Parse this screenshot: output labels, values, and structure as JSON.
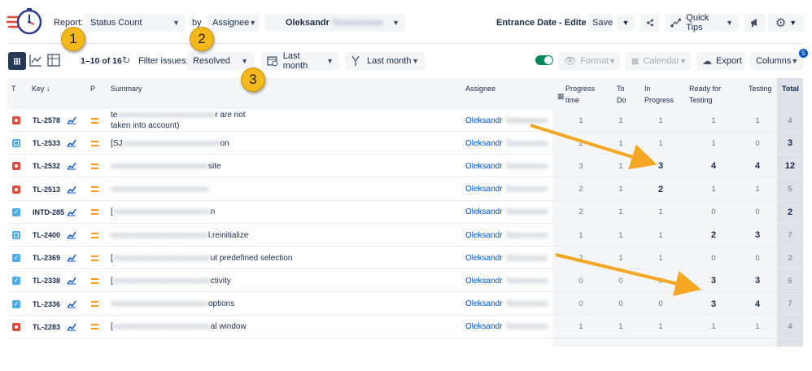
{
  "header": {
    "report_label": "Report:",
    "report_value": "Status Count",
    "by_label": "by",
    "group_value": "Assignee",
    "assignee_value": "Oleksandr",
    "entrance_title": "Entrance Date - Edited",
    "save_label": "Save",
    "quick_tips_label": "Quick Tips"
  },
  "toolbar": {
    "pagination": "1–10 of 16",
    "filter_label": "Filter issues:",
    "filter_value": "Resolved",
    "date1": "Last month",
    "date2": "Last month",
    "format_label": "Format",
    "calendar_label": "Calendar",
    "export_label": "Export",
    "columns_label": "Columns",
    "columns_badge": "5"
  },
  "markers": [
    "1",
    "2",
    "3"
  ],
  "columns": {
    "t": "T",
    "key": "Key",
    "p": "P",
    "summary": "Summary",
    "assignee": "Assignee",
    "progress_time": "Progress time",
    "todo": "To Do",
    "in_progress": "In Progress",
    "ready": "Ready for Testing",
    "testing": "Testing",
    "total": "Total"
  },
  "rows": [
    {
      "type": "bug",
      "key": "TL-2578",
      "summary_a": "te",
      "summary_b": "r are not",
      "summary_c": "taken into account)",
      "assignee": "Oleksandr",
      "pt": "1",
      "todo": "1",
      "inp": "1",
      "ready": "1",
      "testing": "1",
      "total": "4"
    },
    {
      "type": "story",
      "key": "TL-2533",
      "summary_a": "[SJ",
      "summary_b": "on",
      "summary_c": "",
      "assignee": "Oleksandr",
      "pt": "2",
      "todo": "1",
      "inp": "1",
      "ready": "1",
      "testing": "0",
      "total": "3"
    },
    {
      "type": "bug",
      "key": "TL-2532",
      "summary_a": "",
      "summary_b": "site",
      "summary_c": "",
      "assignee": "Oleksandr",
      "pt": "3",
      "todo": "1",
      "inp": "3",
      "ready": "4",
      "testing": "4",
      "total": "12"
    },
    {
      "type": "bug",
      "key": "TL-2513",
      "summary_a": "",
      "summary_b": "",
      "summary_c": "",
      "assignee": "Oleksandr",
      "pt": "2",
      "todo": "1",
      "inp": "2",
      "ready": "1",
      "testing": "1",
      "total": "5"
    },
    {
      "type": "task",
      "key": "INTD-285",
      "summary_a": "[",
      "summary_b": "n",
      "summary_c": "",
      "assignee": "Oleksandr",
      "pt": "2",
      "todo": "1",
      "inp": "1",
      "ready": "0",
      "testing": "0",
      "total": "2"
    },
    {
      "type": "story",
      "key": "TL-2400",
      "summary_a": "",
      "summary_b": "l.reinitialize",
      "summary_c": "",
      "assignee": "Oleksandr",
      "pt": "1",
      "todo": "1",
      "inp": "1",
      "ready": "2",
      "testing": "3",
      "total": "7"
    },
    {
      "type": "task",
      "key": "TL-2369",
      "summary_a": "[",
      "summary_b": "ut predefined selection",
      "summary_c": "",
      "assignee": "Oleksandr",
      "pt": "2",
      "todo": "1",
      "inp": "1",
      "ready": "0",
      "testing": "0",
      "total": "2"
    },
    {
      "type": "task",
      "key": "TL-2338",
      "summary_a": "[",
      "summary_b": "ctivity",
      "summary_c": "",
      "assignee": "Oleksandr",
      "pt": "0",
      "todo": "0",
      "inp": "0",
      "ready": "3",
      "testing": "3",
      "total": "6"
    },
    {
      "type": "task",
      "key": "TL-2336",
      "summary_a": "",
      "summary_b": "options",
      "summary_c": "",
      "assignee": "Oleksandr",
      "pt": "0",
      "todo": "0",
      "inp": "0",
      "ready": "3",
      "testing": "4",
      "total": "7"
    },
    {
      "type": "bug",
      "key": "TL-2283",
      "summary_a": "[",
      "summary_b": "al window",
      "summary_c": "",
      "assignee": "Oleksandr",
      "pt": "1",
      "todo": "1",
      "inp": "1",
      "ready": "1",
      "testing": "1",
      "total": "4"
    }
  ],
  "colors": {
    "bug": "#e5493a",
    "story": "#4bade8",
    "task": "#4bade8",
    "link": "#0052cc",
    "arrow": "#f5a623"
  }
}
